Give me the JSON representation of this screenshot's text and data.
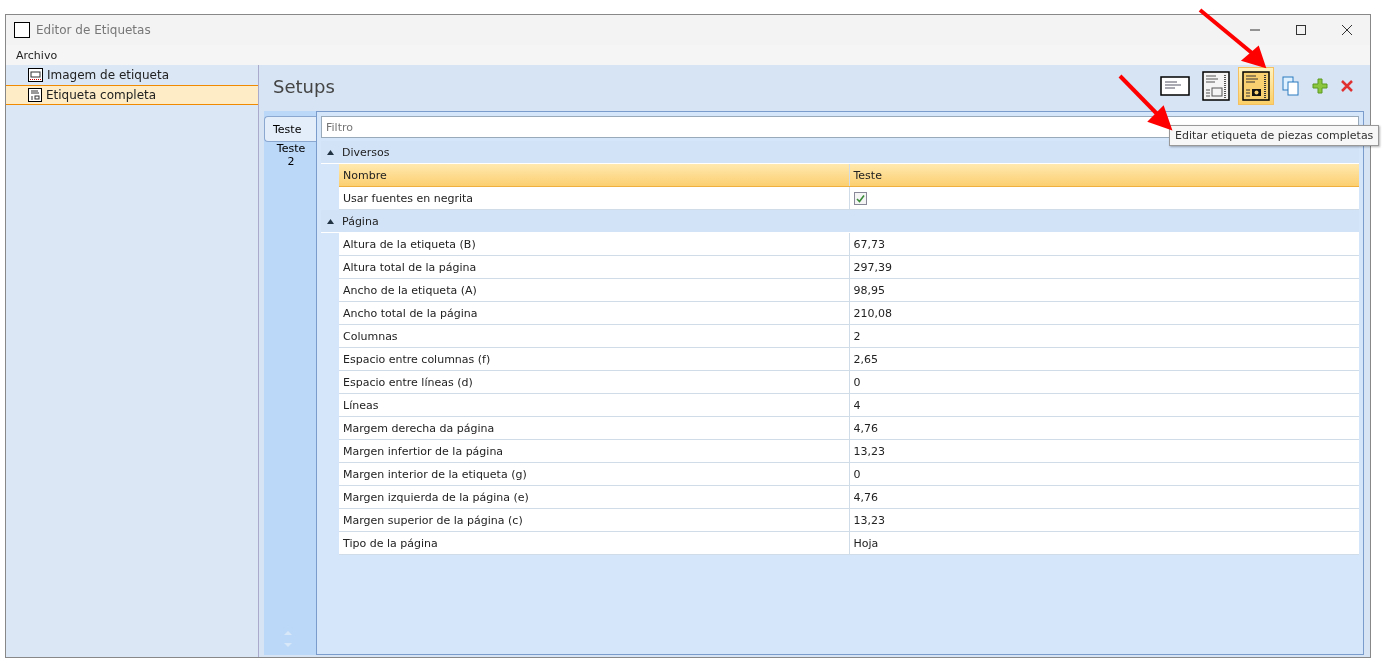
{
  "window": {
    "title": "Editor de Etiquetas"
  },
  "menu": [
    "Archivo"
  ],
  "sidebar": {
    "items": [
      {
        "label": "Imagem de etiqueta",
        "kind": "image",
        "selected": false
      },
      {
        "label": "Etiqueta completa",
        "kind": "full",
        "selected": true
      }
    ]
  },
  "panel": {
    "title": "Setups",
    "toolbar": [
      {
        "kind": "label",
        "selected": false
      },
      {
        "kind": "label-image",
        "selected": false
      },
      {
        "kind": "label-camera",
        "selected": true
      },
      {
        "kind": "copy",
        "selected": false
      },
      {
        "kind": "add",
        "selected": false
      },
      {
        "kind": "delete",
        "selected": false
      }
    ],
    "tooltip": "Editar etiqueta de piezas completas"
  },
  "tabs": [
    {
      "label": "Teste",
      "selected": true
    },
    {
      "label": "Teste 2",
      "selected": false
    }
  ],
  "filter": {
    "placeholder": "Filtro"
  },
  "groups": [
    {
      "title": "Diversos",
      "expanded": true,
      "rows": [
        {
          "kind": "header",
          "name": "Nombre",
          "value": "Teste"
        },
        {
          "kind": "checkbox",
          "name": "Usar fuentes en negrita",
          "checked": true
        }
      ]
    },
    {
      "title": "Página",
      "expanded": true,
      "rows": [
        {
          "kind": "text",
          "name": "Altura de la etiqueta (B)",
          "value": "67,73"
        },
        {
          "kind": "text",
          "name": "Altura total de la página",
          "value": "297,39"
        },
        {
          "kind": "text",
          "name": "Ancho de la etiqueta (A)",
          "value": "98,95"
        },
        {
          "kind": "text",
          "name": "Ancho total de la página",
          "value": "210,08"
        },
        {
          "kind": "text",
          "name": "Columnas",
          "value": "2"
        },
        {
          "kind": "text",
          "name": "Espacio entre columnas (f)",
          "value": "2,65"
        },
        {
          "kind": "text",
          "name": "Espacio entre líneas (d)",
          "value": "0"
        },
        {
          "kind": "text",
          "name": "Líneas",
          "value": "4"
        },
        {
          "kind": "text",
          "name": "Margem derecha da página",
          "value": "4,76"
        },
        {
          "kind": "text",
          "name": "Margen infertior de la página",
          "value": "13,23"
        },
        {
          "kind": "text",
          "name": "Margen interior de la etiqueta (g)",
          "value": "0"
        },
        {
          "kind": "text",
          "name": "Margen izquierda de la página (e)",
          "value": "4,76"
        },
        {
          "kind": "text",
          "name": "Margen superior de la página (c)",
          "value": "13,23"
        },
        {
          "kind": "text",
          "name": "Tipo de la página",
          "value": "Hoja"
        }
      ]
    }
  ]
}
